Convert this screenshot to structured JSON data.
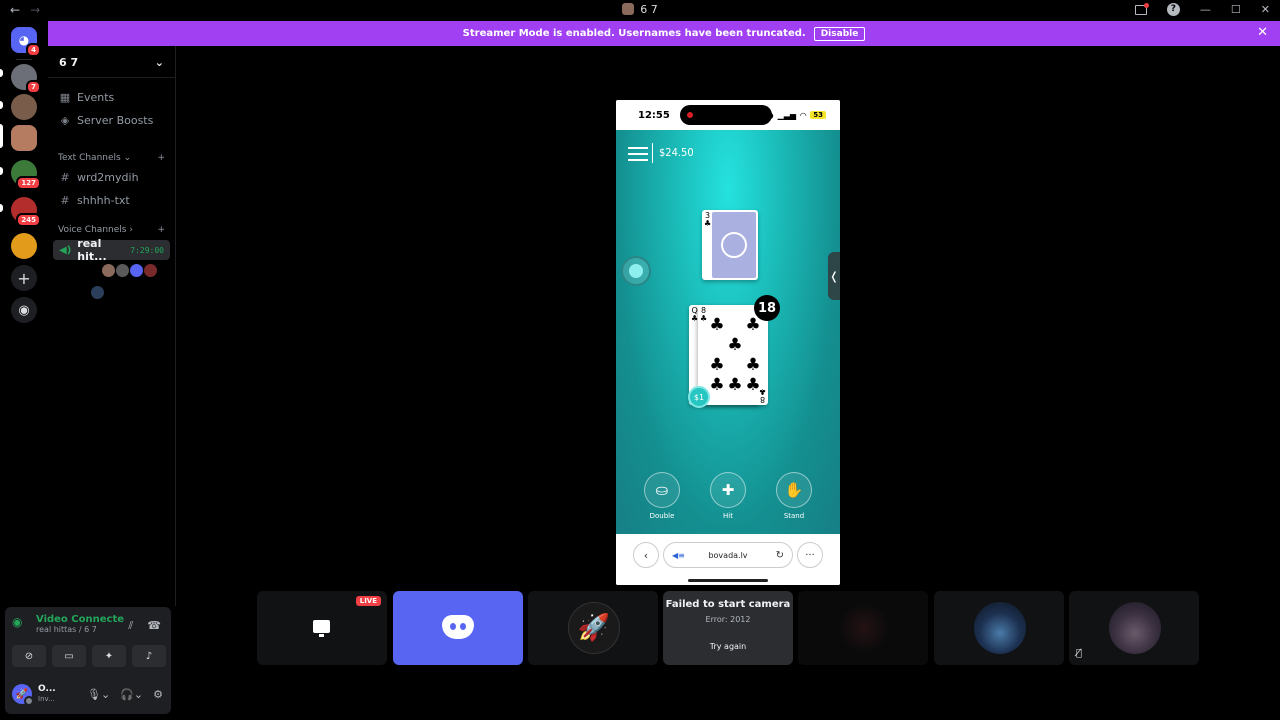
{
  "window": {
    "title": "6 7",
    "back_glyph": "←",
    "forward_glyph": "→",
    "controls": [
      "—",
      "☐",
      "✕"
    ],
    "help_glyph": "?"
  },
  "rail": {
    "home_badge": "4",
    "guilds": [
      {
        "name": "guild-1",
        "badge": "7",
        "color": "#6d6f78"
      },
      {
        "name": "guild-2",
        "badge": "",
        "color": "#7a5c4a"
      },
      {
        "name": "guild-3",
        "badge": "",
        "color": "#b57c62"
      },
      {
        "name": "guild-4",
        "badge": "127",
        "color": "#3c7a3a"
      },
      {
        "name": "guild-5",
        "badge": "245",
        "color": "#b32d2d"
      },
      {
        "name": "guild-6",
        "badge": "",
        "color": "#e39b1b"
      }
    ],
    "add_glyph": "+",
    "explore_glyph": "◉"
  },
  "banner": {
    "text": "Streamer Mode is enabled. Usernames have been truncated.",
    "button": "Disable",
    "close_glyph": "✕"
  },
  "server": {
    "name": "6 7",
    "chevron": "⌄",
    "events": "Events",
    "boosts": "Server Boosts",
    "text_category": "Text Channels",
    "voice_category": "Voice Channels",
    "text_channels": [
      "wrd2mydih",
      "shhhh-txt"
    ],
    "voice_channel": "real hit...",
    "voice_timer": "7:29:00",
    "hash": "#"
  },
  "userpanel": {
    "status": "Video Connecte",
    "location": "real hittas / 6 7",
    "username": "O...",
    "substatus": "Inv..."
  },
  "phone": {
    "time": "12:55",
    "battery": "53",
    "balance": "$24.50",
    "dealer_card_rank": "3",
    "dealer_card_suit": "♣",
    "card1_rank": "Q",
    "card2_rank": "8",
    "suit": "♣",
    "hand_total": "18",
    "bet_chip": "$1",
    "collapse_glyph": "❬",
    "actions": [
      {
        "label": "Double",
        "glyph": "⛀"
      },
      {
        "label": "Hit",
        "glyph": "✚"
      },
      {
        "label": "Stand",
        "glyph": "✋"
      }
    ],
    "url": "bovada.lv",
    "more_glyph": "···",
    "back_glyph": "‹",
    "reload_glyph": "↻"
  },
  "tiles": {
    "live_badge": "LIVE",
    "fail_title": "Failed to start camera",
    "fail_error": "Error: 2012",
    "retry_label": "Try again"
  },
  "colors": {
    "banner": "#a13ff2",
    "discord": "#5865f2",
    "connected": "#23a55a",
    "game_teal": "#1ab9b6"
  }
}
